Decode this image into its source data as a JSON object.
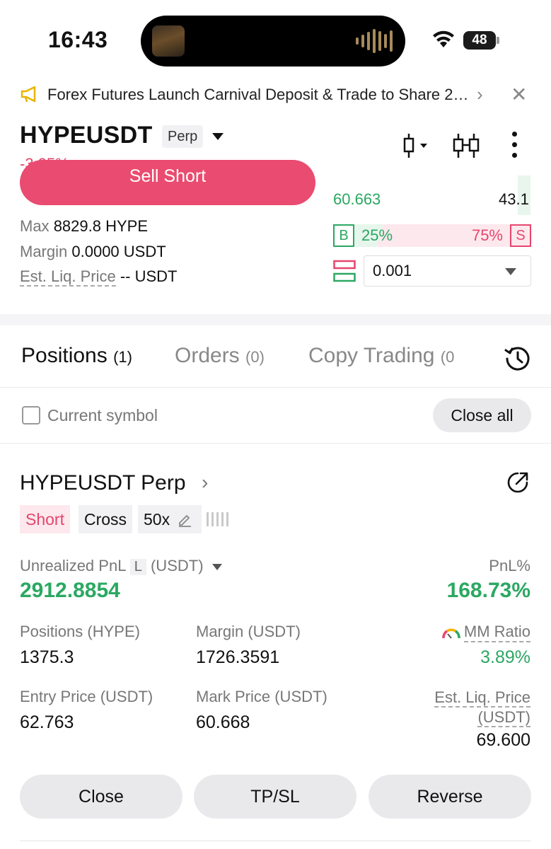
{
  "status_bar": {
    "time": "16:43",
    "battery": "48"
  },
  "announcement": {
    "text": "Forex Futures Launch Carnival Deposit & Trade to Share 2…"
  },
  "header": {
    "symbol": "HYPEUSDT",
    "tag": "Perp",
    "change": "-3.25%"
  },
  "order_form": {
    "sell_label": "Sell Short",
    "max_label": "Max",
    "max_value": "8829.8 HYPE",
    "margin_label": "Margin",
    "margin_value": "0.0000 USDT",
    "liq_label": "Est. Liq. Price",
    "liq_value": "-- USDT"
  },
  "order_book": {
    "bid_price": "60.663",
    "bid_qty": "43.1",
    "buy_letter": "B",
    "buy_pct": "25%",
    "sell_pct": "75%",
    "sell_letter": "S",
    "buy_ratio": 0.25,
    "precision": "0.001"
  },
  "tabs": [
    {
      "label": "Positions",
      "count": "(1)"
    },
    {
      "label": "Orders",
      "count": "(0)"
    },
    {
      "label": "Copy Trading",
      "count": "(0"
    }
  ],
  "filter": {
    "checkbox_label": "Current symbol",
    "close_all": "Close all"
  },
  "position": {
    "title": "HYPEUSDT Perp",
    "tags": {
      "side": "Short",
      "mode": "Cross",
      "leverage": "50x"
    },
    "upnl_label": "Unrealized PnL",
    "upnl_l": "L",
    "upnl_unit": "(USDT)",
    "upnl_value": "2912.8854",
    "pnl_pct_label": "PnL%",
    "pnl_pct_value": "168.73%",
    "positions_label": "Positions (HYPE)",
    "positions_value": "1375.3",
    "margin_label": "Margin (USDT)",
    "margin_value": "1726.3591",
    "mm_label": "MM Ratio",
    "mm_value": "3.89%",
    "entry_label": "Entry Price (USDT)",
    "entry_value": "62.763",
    "mark_label": "Mark Price (USDT)",
    "mark_value": "60.668",
    "liq_label_1": "Est. Liq. Price",
    "liq_label_2": "(USDT)",
    "liq_value": "69.600"
  },
  "actions": {
    "close": "Close",
    "tpsl": "TP/SL",
    "reverse": "Reverse"
  },
  "colors": {
    "red": "#e5466d",
    "green": "#2ba862",
    "sell_button": "#ea4b70"
  }
}
